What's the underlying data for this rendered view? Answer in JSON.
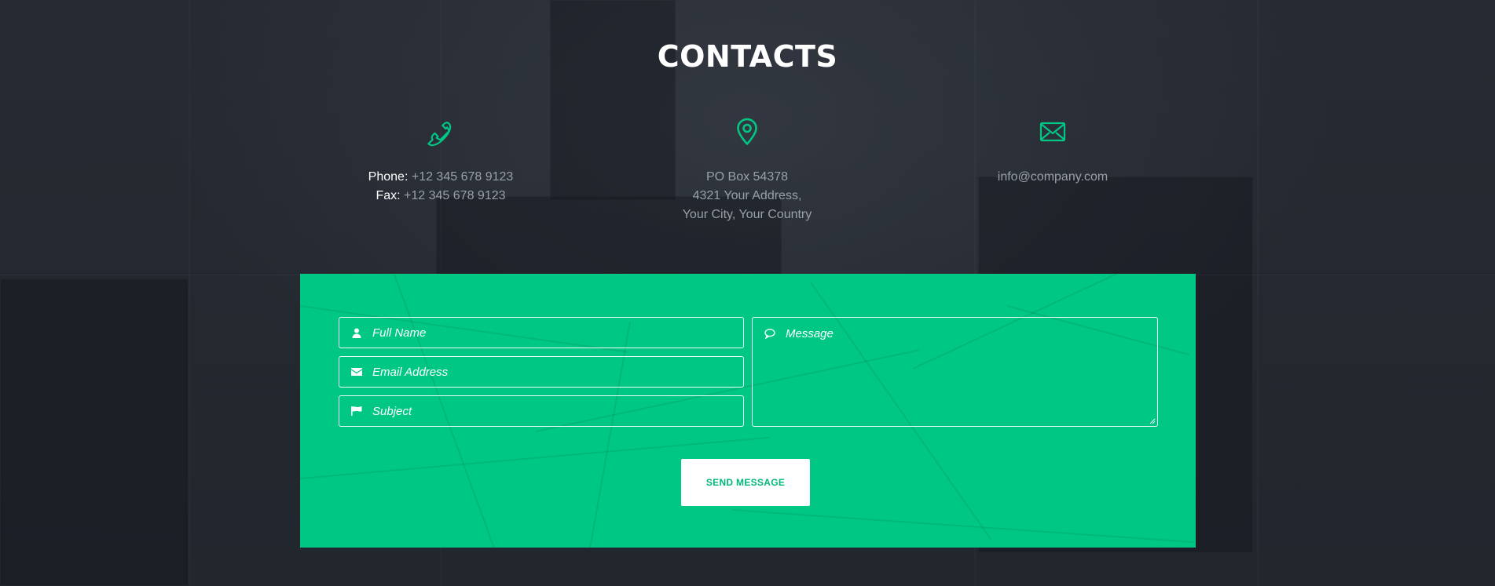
{
  "page": {
    "title": "CONTACTS"
  },
  "contacts": {
    "phone": {
      "icon": "phone-icon",
      "phone_label": "Phone:",
      "phone_value": "+12 345 678 9123",
      "fax_label": "Fax:",
      "fax_value": "+12 345 678 9123"
    },
    "address": {
      "icon": "map-pin-icon",
      "line1": "PO Box 54378",
      "line2": "4321 Your Address,",
      "line3": "Your City, Your Country"
    },
    "email": {
      "icon": "envelope-icon",
      "value": "info@company.com"
    }
  },
  "form": {
    "full_name_placeholder": "Full Name",
    "email_placeholder": "Email Address",
    "subject_placeholder": "Subject",
    "message_placeholder": "Message",
    "send_label": "SEND MESSAGE"
  },
  "colors": {
    "accent": "#00c884",
    "background": "#23272f",
    "text_muted": "#9aa0a8",
    "white": "#ffffff"
  }
}
